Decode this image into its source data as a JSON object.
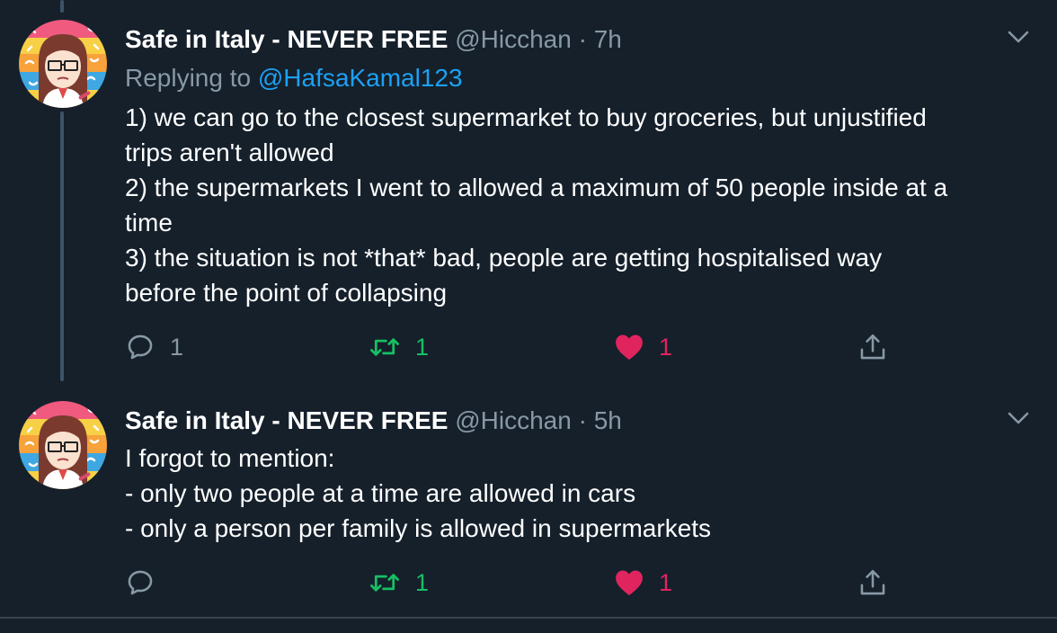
{
  "colors": {
    "background": "#15202b",
    "secondary_text": "#8899a6",
    "link": "#1da1f2",
    "retweet_active": "#17bf63",
    "like_active": "#e0245e",
    "divider": "#38444d"
  },
  "tweets": [
    {
      "name": "Safe in Italy - NEVER FREE",
      "handle": "@Hicchan",
      "separator": "·",
      "time": "7h",
      "replying_prefix": "Replying to",
      "replying_to": "@HafsaKamal123",
      "lines": [
        "1) we can go to the closest supermarket to buy groceries, but unjustified",
        "trips aren't allowed",
        "2) the supermarkets I went to allowed a maximum of 50 people inside at a",
        "time",
        "3) the situation is not *that* bad, people are getting hospitalised way",
        "before the point of collapsing"
      ],
      "reply_count": "1",
      "retweet_count": "1",
      "like_count": "1",
      "icons": {
        "reply": "reply-icon",
        "retweet": "retweet-icon",
        "like": "heart-icon",
        "share": "share-icon",
        "menu": "chevron-down-icon"
      }
    },
    {
      "name": "Safe in Italy - NEVER FREE",
      "handle": "@Hicchan",
      "separator": "·",
      "time": "5h",
      "lines": [
        "I forgot to mention:",
        "- only two people at a time are allowed in cars",
        "- only a person per family is allowed in supermarkets"
      ],
      "reply_count": "",
      "retweet_count": "1",
      "like_count": "1",
      "icons": {
        "reply": "reply-icon",
        "retweet": "retweet-icon",
        "like": "heart-icon",
        "share": "share-icon",
        "menu": "chevron-down-icon"
      }
    }
  ]
}
